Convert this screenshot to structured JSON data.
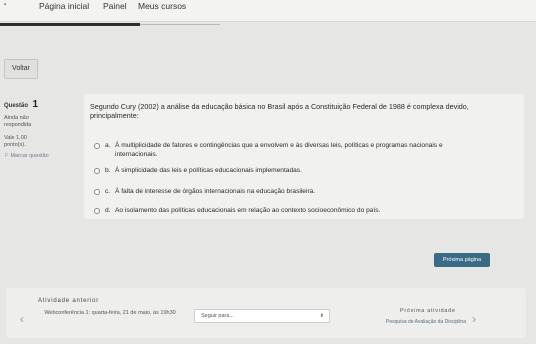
{
  "topbar": {
    "logo_glyph": "▪",
    "nav": [
      "Página inicial",
      "Painel",
      "Meus cursos"
    ]
  },
  "back_button": {
    "label": "Voltar"
  },
  "question_info": {
    "label": "Questão",
    "number": "1",
    "status": "Ainda não respondida",
    "score": "Vale 1,00 ponto(s).",
    "flag_label": "Marcar questão",
    "flag_icon": "flag-icon"
  },
  "question": {
    "text": "Segundo Cury (2002) a análise da educação básica no Brasil após a Constituição Federal de 1988 é complexa devido, principalmente:",
    "options": [
      {
        "letter": "a.",
        "text": "À multiplicidade de fatores e contingências que a envolvem e às diversas leis, políticas e programas nacionais e internacionais."
      },
      {
        "letter": "b.",
        "text": "À simplicidade das leis e políticas educacionais implementadas."
      },
      {
        "letter": "c.",
        "text": "À falta de interesse de órgãos internacionais na educação brasileira."
      },
      {
        "letter": "d.",
        "text": "Ao isolamento das políticas educacionais em relação ao contexto socioeconômico do país."
      }
    ]
  },
  "next_page_button": {
    "label": "Próxima página"
  },
  "activity_nav": {
    "prev_title": "Atividade anterior",
    "prev_link": "Webconferência 1: quarta-feira, 21 de maio, às 19h30",
    "jump_placeholder": "Seguir para...",
    "next_title": "Próxima atividade",
    "next_link": "Pesquisa de Avaliação da Disciplina"
  },
  "colors": {
    "primary_button": "#3a6b86",
    "page_bg": "#e6e6e4",
    "card_bg": "#f1f1ef"
  }
}
